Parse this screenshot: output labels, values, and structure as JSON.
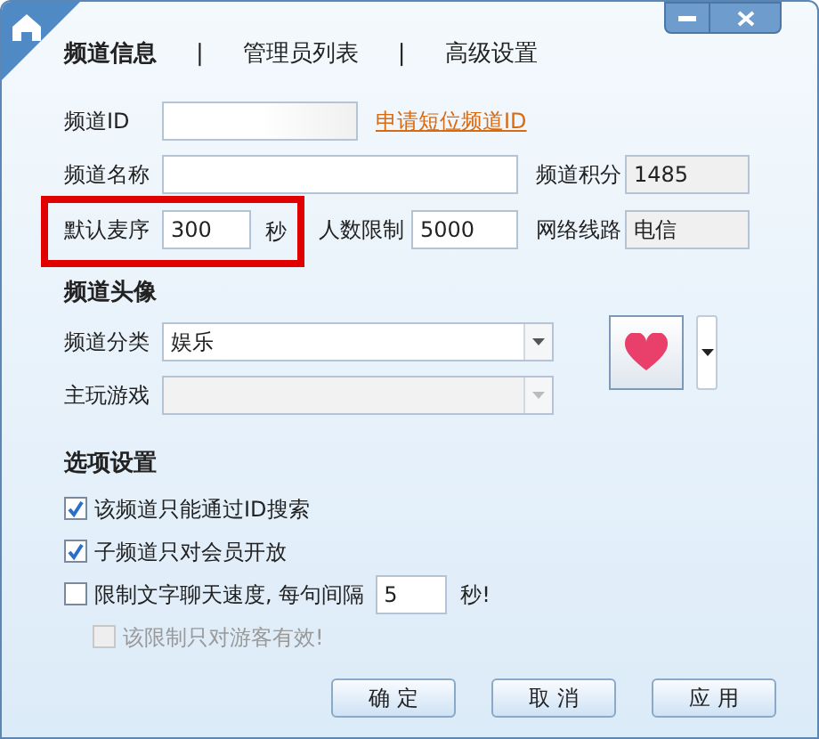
{
  "tabs": [
    {
      "label": "频道信息",
      "selected": true
    },
    {
      "label": "管理员列表",
      "selected": false
    },
    {
      "label": "高级设置",
      "selected": false
    }
  ],
  "tab_separator": "|",
  "channel_id": {
    "label": "频道ID",
    "link": "申请短位频道ID"
  },
  "channel_name": {
    "label": "频道名称"
  },
  "channel_points": {
    "label": "频道积分",
    "value": "1485"
  },
  "mic_order": {
    "label": "默认麦序",
    "value": "300",
    "unit": "秒",
    "highlighted": true
  },
  "member_limit": {
    "label": "人数限制",
    "value": "5000"
  },
  "network": {
    "label": "网络线路",
    "value": "电信"
  },
  "avatar_section": {
    "title": "频道头像"
  },
  "category": {
    "label": "频道分类",
    "value": "娱乐",
    "disabled": false
  },
  "main_game": {
    "label": "主玩游戏",
    "disabled": true
  },
  "options_section": {
    "title": "选项设置"
  },
  "options": [
    {
      "kind": "check",
      "label": "该频道只能通过ID搜索",
      "checked": true,
      "disabled": false
    },
    {
      "kind": "check",
      "label": "子频道只对会员开放",
      "checked": true,
      "disabled": false
    },
    {
      "kind": "interval",
      "label": "限制文字聊天速度, 每句间隔",
      "value": "5",
      "unit": "秒!",
      "checked": false,
      "disabled": false
    },
    {
      "kind": "sub",
      "label": "该限制只对游客有效!",
      "checked": false,
      "disabled": true
    }
  ],
  "buttons": [
    "确 定",
    "取 消",
    "应 用"
  ]
}
